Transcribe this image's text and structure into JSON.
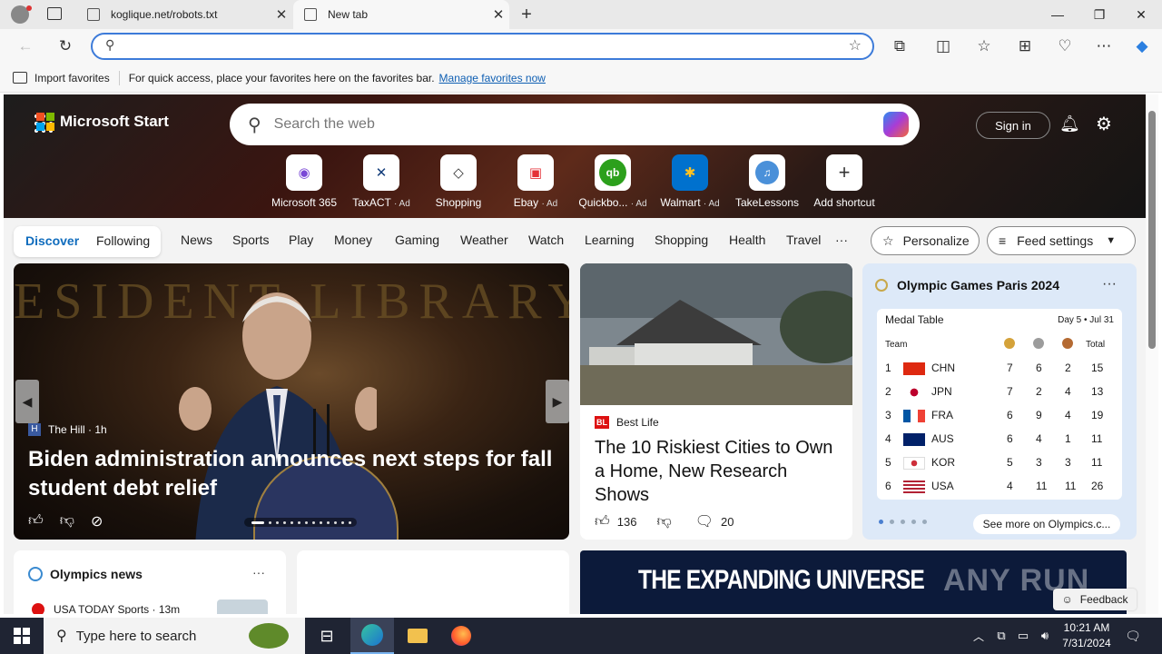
{
  "browser": {
    "tabs": [
      {
        "title": "koglique.net/robots.txt"
      },
      {
        "title": "New tab"
      }
    ],
    "address_placeholder": ""
  },
  "favorites_bar": {
    "import_label": "Import favorites",
    "hint": "For quick access, place your favorites here on the favorites bar.",
    "manage_link": "Manage favorites now"
  },
  "header": {
    "brand": "Microsoft Start",
    "search_placeholder": "Search the web",
    "signin": "Sign in"
  },
  "shortcuts": [
    {
      "label": "Microsoft 365",
      "ad": ""
    },
    {
      "label": "TaxACT",
      "ad": "· Ad"
    },
    {
      "label": "Shopping",
      "ad": ""
    },
    {
      "label": "Ebay",
      "ad": "· Ad"
    },
    {
      "label": "Quickbo...",
      "ad": "· Ad"
    },
    {
      "label": "Walmart",
      "ad": "· Ad"
    },
    {
      "label": "TakeLessons",
      "ad": ""
    },
    {
      "label": "Add shortcut",
      "ad": ""
    }
  ],
  "nav": {
    "discover": "Discover",
    "following": "Following",
    "items": [
      "News",
      "Sports",
      "Play",
      "Money",
      "Gaming",
      "Weather",
      "Watch",
      "Learning",
      "Shopping",
      "Health",
      "Travel"
    ],
    "more": "···",
    "personalize": "Personalize",
    "feed_settings": "Feed settings"
  },
  "main_story": {
    "bg_text": "ESIDENT LIBRARY",
    "source": "The Hill · 1h",
    "headline": "Biden administration announces next steps for fall student debt relief"
  },
  "mid_story": {
    "source": "Best Life",
    "headline": "The 10 Riskiest Cities to Own a Home, New Research Shows",
    "likes": "136",
    "comments": "20"
  },
  "olympics": {
    "title": "Olympic Games Paris 2024",
    "table_title": "Medal Table",
    "day": "Day 5 • Jul 31",
    "col_team": "Team",
    "col_total": "Total",
    "rows": [
      {
        "rank": "1",
        "code": "CHN",
        "gold": "7",
        "silver": "6",
        "bronze": "2",
        "total": "15"
      },
      {
        "rank": "2",
        "code": "JPN",
        "gold": "7",
        "silver": "2",
        "bronze": "4",
        "total": "13"
      },
      {
        "rank": "3",
        "code": "FRA",
        "gold": "6",
        "silver": "9",
        "bronze": "4",
        "total": "19"
      },
      {
        "rank": "4",
        "code": "AUS",
        "gold": "6",
        "silver": "4",
        "bronze": "1",
        "total": "11"
      },
      {
        "rank": "5",
        "code": "KOR",
        "gold": "5",
        "silver": "3",
        "bronze": "3",
        "total": "11"
      },
      {
        "rank": "6",
        "code": "USA",
        "gold": "4",
        "silver": "11",
        "bronze": "11",
        "total": "26"
      }
    ],
    "see_more": "See more on Olympics.c..."
  },
  "olympics_news": {
    "title": "Olympics news",
    "source": "USA TODAY Sports · 13m"
  },
  "ad_banner": {
    "text": "THE EXPANDING UNIVERSE"
  },
  "watermark": "ANY RUN",
  "feedback": "Feedback",
  "taskbar": {
    "search_placeholder": "Type here to search",
    "time": "10:21 AM",
    "date": "7/31/2024"
  },
  "colors": {
    "accent": "#0f6cbd",
    "taskbar": "#1f2433"
  }
}
